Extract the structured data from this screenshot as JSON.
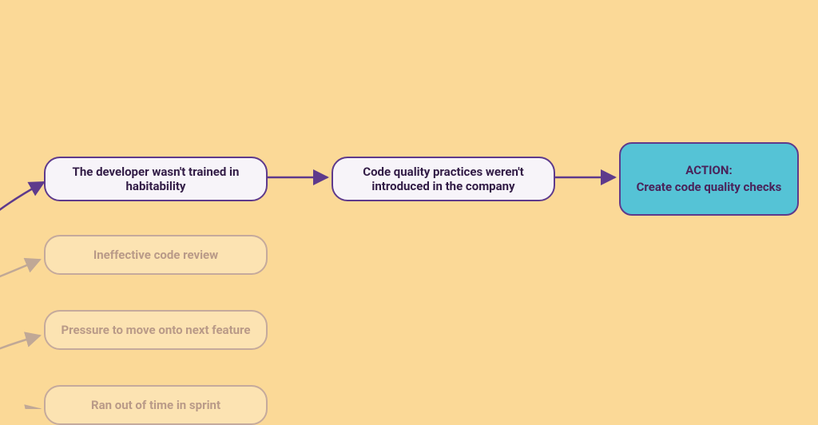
{
  "nodes": {
    "n1": "The developer wasn't trained in habitability",
    "n2": "Code quality practices weren't introduced in the company",
    "n3_line1": "ACTION:",
    "n3_line2": "Create code quality checks",
    "f1": "Ineffective code review",
    "f2": "Pressure to move onto next feature",
    "f3": "Ran out of time in sprint"
  },
  "colors": {
    "bg": "#fbd997",
    "node_primary_bg": "#f7f4f9",
    "node_primary_border": "#5e3a8c",
    "node_primary_text": "#321c46",
    "node_faded_bg": "#fce3b2",
    "node_faded_border": "#c5aa9c",
    "node_faded_text": "#b99a88",
    "node_action_bg": "#55c3d6",
    "node_action_border": "#5e3a8c",
    "node_action_text": "#4a235a",
    "arrow_primary": "#5e3a8c",
    "arrow_faded": "#c0a896"
  }
}
